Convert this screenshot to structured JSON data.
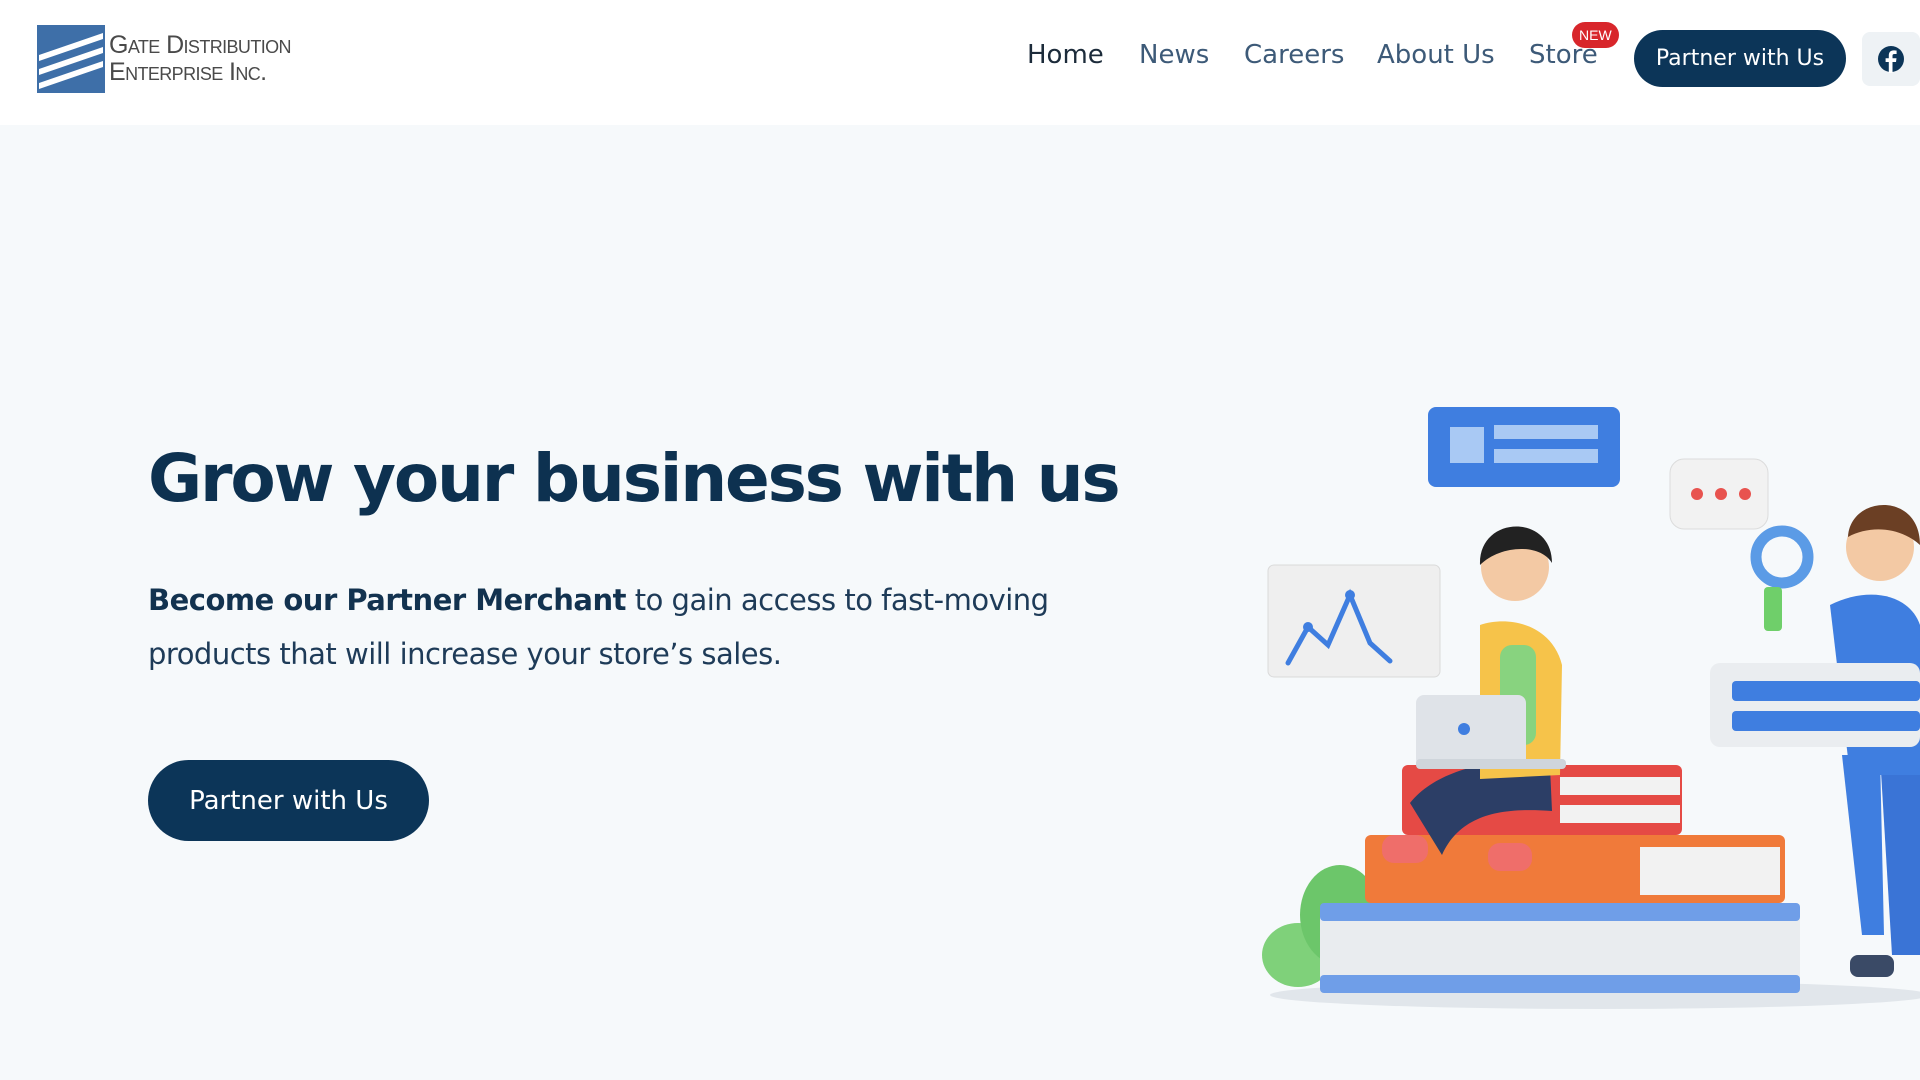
{
  "header": {
    "logo": {
      "line1": "Gate Distribution",
      "line2": "Enterprise  Inc."
    },
    "nav": [
      {
        "label": "Home",
        "active": true
      },
      {
        "label": "News"
      },
      {
        "label": "Careers"
      },
      {
        "label": "About Us"
      },
      {
        "label": "Store",
        "badge": "NEW"
      }
    ],
    "cta_label": "Partner with Us",
    "social_icon": "facebook-icon"
  },
  "hero": {
    "title": "Grow your business with us",
    "description_bold": "Become our Partner Merchant",
    "description_rest": " to gain access to fast-moving products that will increase your store’s sales.",
    "cta_label": "Partner with Us"
  },
  "colors": {
    "brand_navy": "#0c3558",
    "logo_blue": "#3e6fa8",
    "badge_red": "#d8262b",
    "background": "#f6f9fb"
  }
}
